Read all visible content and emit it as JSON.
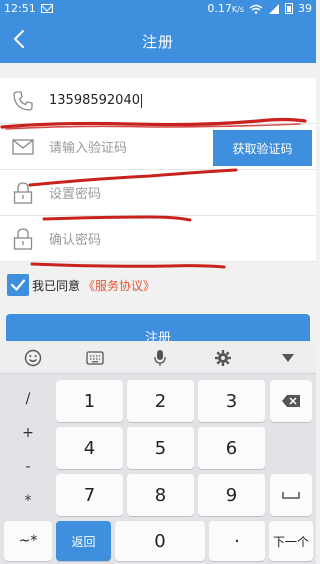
{
  "status_bar": {
    "time": "12:51",
    "network_speed": "0.17",
    "network_unit": "K/s",
    "battery": "39"
  },
  "header": {
    "title": "注册"
  },
  "form": {
    "phone": {
      "value": "13598592040"
    },
    "code": {
      "placeholder": "请输入验证码",
      "button_label": "获取验证码"
    },
    "password": {
      "placeholder": "设置密码"
    },
    "confirm_password": {
      "placeholder": "确认密码"
    }
  },
  "agreement": {
    "checked": true,
    "text": "我已同意",
    "link": "《服务协议》"
  },
  "register_button": {
    "label": "注册"
  },
  "keyboard": {
    "toolbar_icons": [
      "emoji-icon",
      "keyboard-layout-icon",
      "microphone-icon",
      "settings-icon",
      "collapse-icon"
    ],
    "symbols": [
      "/",
      "+",
      "-",
      "*"
    ],
    "digits": [
      "1",
      "2",
      "3",
      "4",
      "5",
      "6",
      "7",
      "8",
      "9",
      "0"
    ],
    "mode_key": "~*",
    "back_key": "返回",
    "dot_key": "·",
    "next_key": "下一个"
  },
  "colors": {
    "brand_blue": "#3f8fdf",
    "link_red": "#e25537",
    "scribble_red": "#c8221e"
  }
}
